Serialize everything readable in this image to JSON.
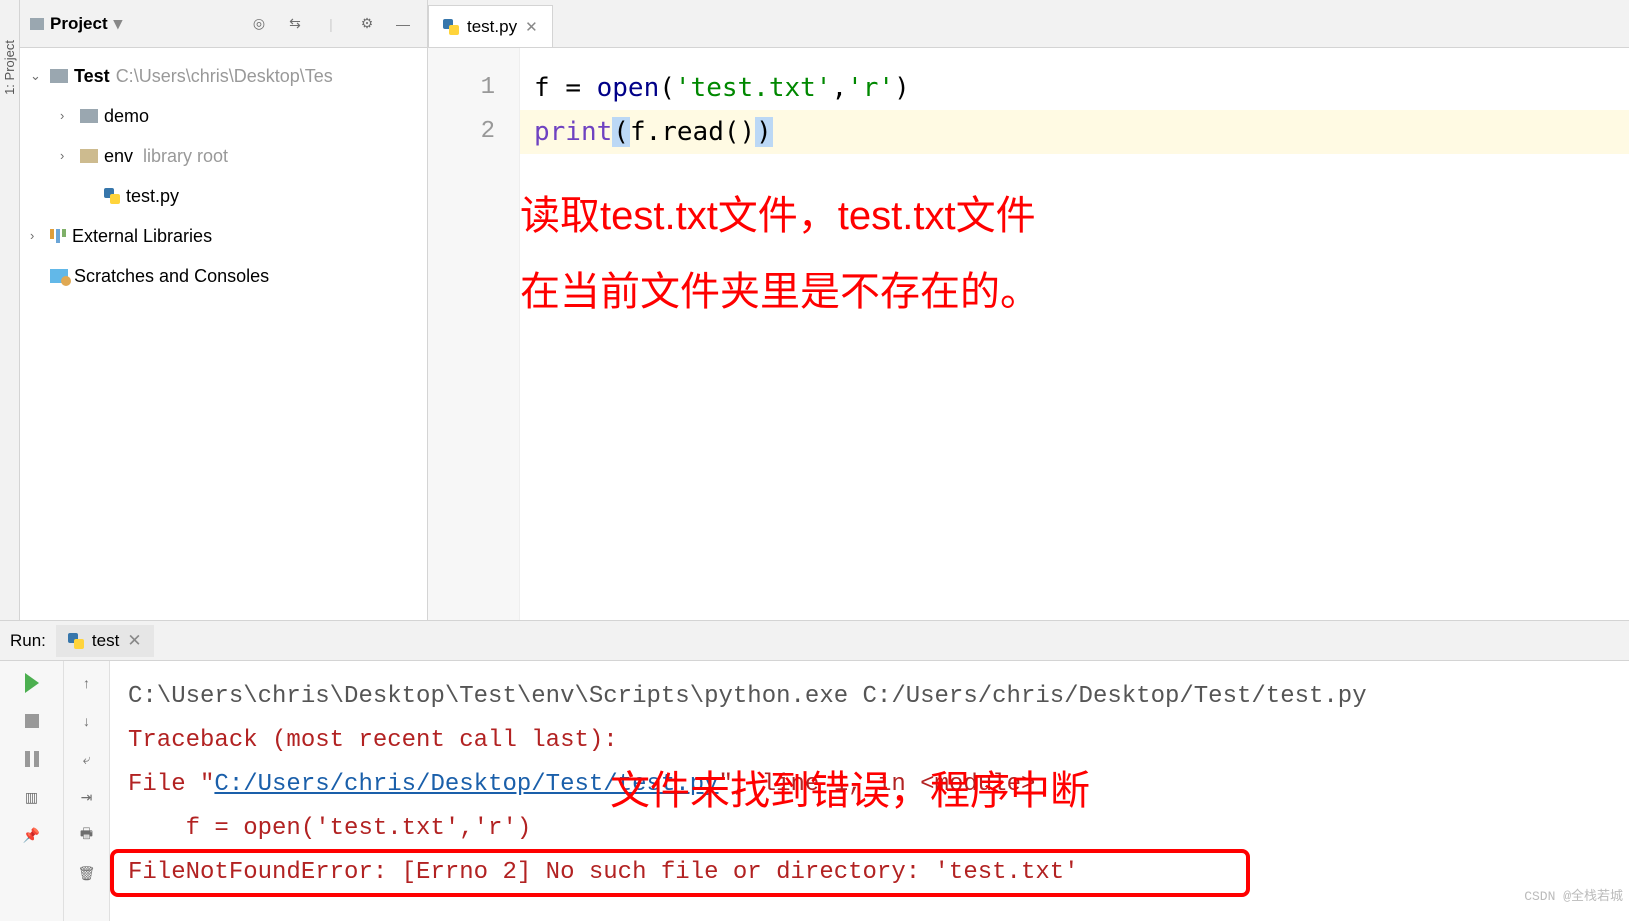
{
  "sidebar": {
    "tab_label": "1: Project"
  },
  "project": {
    "title": "Project",
    "tree": {
      "root_name": "Test",
      "root_path": "C:\\Users\\chris\\Desktop\\Tes",
      "children": {
        "demo": "demo",
        "env": "env",
        "env_hint": "library root",
        "testpy": "test.py"
      },
      "ext_libs": "External Libraries",
      "scratches": "Scratches and Consoles"
    }
  },
  "editor": {
    "tab": {
      "label": "test.py"
    },
    "gutter": [
      "1",
      "2"
    ],
    "code": {
      "line1": {
        "var": "f ",
        "eq": "= ",
        "fn": "open",
        "p1": "(",
        "s1": "'test.txt'",
        "c": ",",
        "s2": "'r'",
        "p2": ")"
      },
      "line2": {
        "fn": "print",
        "p1": "(",
        "expr": "f.read()",
        "p2": ")"
      }
    },
    "annotation_line1": "读取test.txt文件，test.txt文件",
    "annotation_line2": "在当前文件夹里是不存在的。"
  },
  "run": {
    "label": "Run:",
    "tab": "test",
    "cmd": "C:\\Users\\chris\\Desktop\\Test\\env\\Scripts\\python.exe C:/Users/chris/Desktop/Test/test.py",
    "trace_head": "Traceback (most recent call last):",
    "trace_file_pre": "  File \"",
    "trace_file_link": "C:/Users/chris/Desktop/Test/test.py",
    "trace_file_post": "\", line 1, in <module>",
    "trace_src": "    f = open('test.txt','r')",
    "error": "FileNotFoundError: [Errno 2] No such file or directory: 'test.txt'",
    "annotation": "文件未找到错误，程序中断"
  },
  "watermark": "CSDN @全栈若城"
}
